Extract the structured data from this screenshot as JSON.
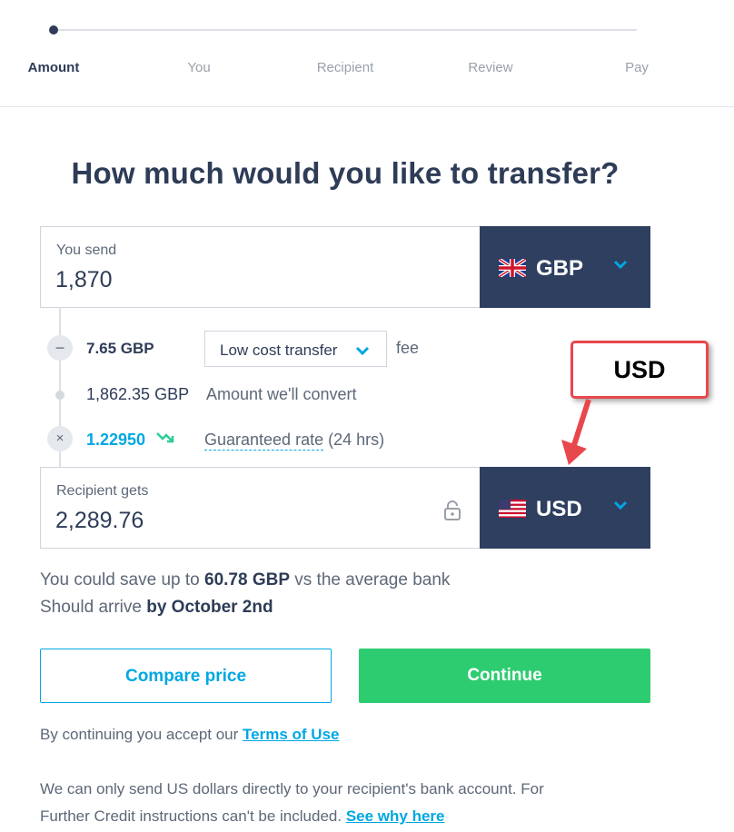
{
  "stepper": {
    "steps": [
      "Amount",
      "You",
      "Recipient",
      "Review",
      "Pay"
    ],
    "active": "Amount"
  },
  "title": "How much would you like to transfer?",
  "send": {
    "label": "You send",
    "amount": "1,870",
    "currency": "GBP",
    "flag_icon": "uk-flag-icon"
  },
  "breakdown": {
    "fee_amount": "7.65 GBP",
    "fee_option": "Low cost transfer",
    "fee_label": "fee",
    "convert_amount": "1,862.35 GBP",
    "convert_label": "Amount we'll convert",
    "rate": "1.22950",
    "rate_label": "Guaranteed rate",
    "rate_duration": "(24 hrs)"
  },
  "receive": {
    "label": "Recipient gets",
    "amount": "2,289.76",
    "currency": "USD",
    "flag_icon": "us-flag-icon"
  },
  "savings": {
    "prefix": "You could save up to",
    "amount": "60.78 GBP",
    "suffix": "vs the average bank"
  },
  "arrival": {
    "prefix": "Should arrive",
    "date": "by October 2nd"
  },
  "buttons": {
    "compare": "Compare price",
    "continue": "Continue"
  },
  "legal": {
    "terms_prefix": "By continuing you accept our",
    "terms_link": "Terms of Use",
    "notice_line1": "We can only send US dollars directly to your recipient's bank account. For",
    "notice_line2": "Further Credit instructions can't be included.",
    "see_why": "See why here"
  },
  "annotation": {
    "callout_text": "USD"
  },
  "colors": {
    "navy": "#2e3f60",
    "accent_blue": "#00a7e3",
    "green": "#2ecc71",
    "callout_red": "#e8474c"
  }
}
